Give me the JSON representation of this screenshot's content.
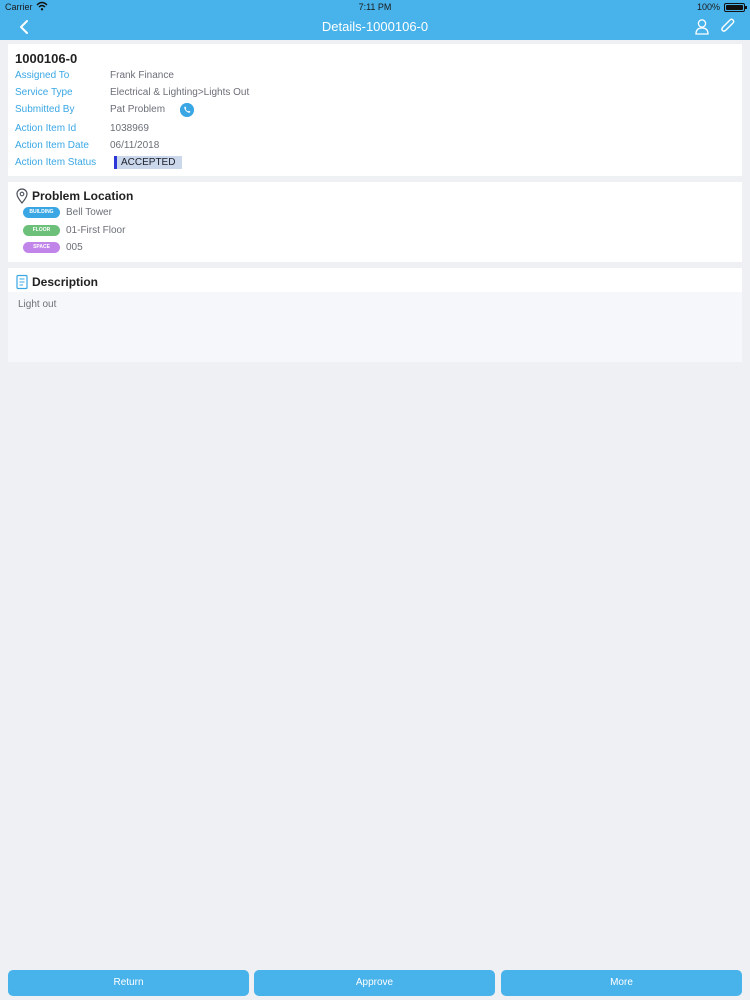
{
  "status_bar": {
    "carrier": "Carrier",
    "time": "7:11 PM",
    "battery": "100%"
  },
  "nav": {
    "title": "Details-1000106-0",
    "icons": [
      "chevron-left-icon",
      "person-icon",
      "paperclip-icon"
    ]
  },
  "details": {
    "id": "1000106-0",
    "rows": [
      {
        "label": "Assigned To",
        "value": "Frank Finance"
      },
      {
        "label": "Service Type",
        "value": "Electrical & Lighting>Lights Out"
      },
      {
        "label": "Submitted By",
        "value": "Pat Problem"
      },
      {
        "label": "Action Item Id",
        "value": "1038969"
      },
      {
        "label": "Action Item Date",
        "value": "06/11/2018"
      },
      {
        "label": "Action Item Status",
        "value": "ACCEPTED"
      }
    ]
  },
  "location": {
    "title": "Problem Location",
    "items": [
      {
        "badge": "BUILDING",
        "value": "Bell Tower",
        "color": "#3aa7e4"
      },
      {
        "badge": "FLOOR",
        "value": "01-First Floor",
        "color": "#6cc07a"
      },
      {
        "badge": "SPACE",
        "value": "005",
        "color": "#c184e8"
      }
    ]
  },
  "description": {
    "title": "Description",
    "text": "Light out"
  },
  "actions": {
    "return": "Return",
    "approve": "Approve",
    "more": "More"
  },
  "colors": {
    "accent": "#48b2ea",
    "label": "#3aa7e4",
    "status_marker": "#2d36d6"
  }
}
